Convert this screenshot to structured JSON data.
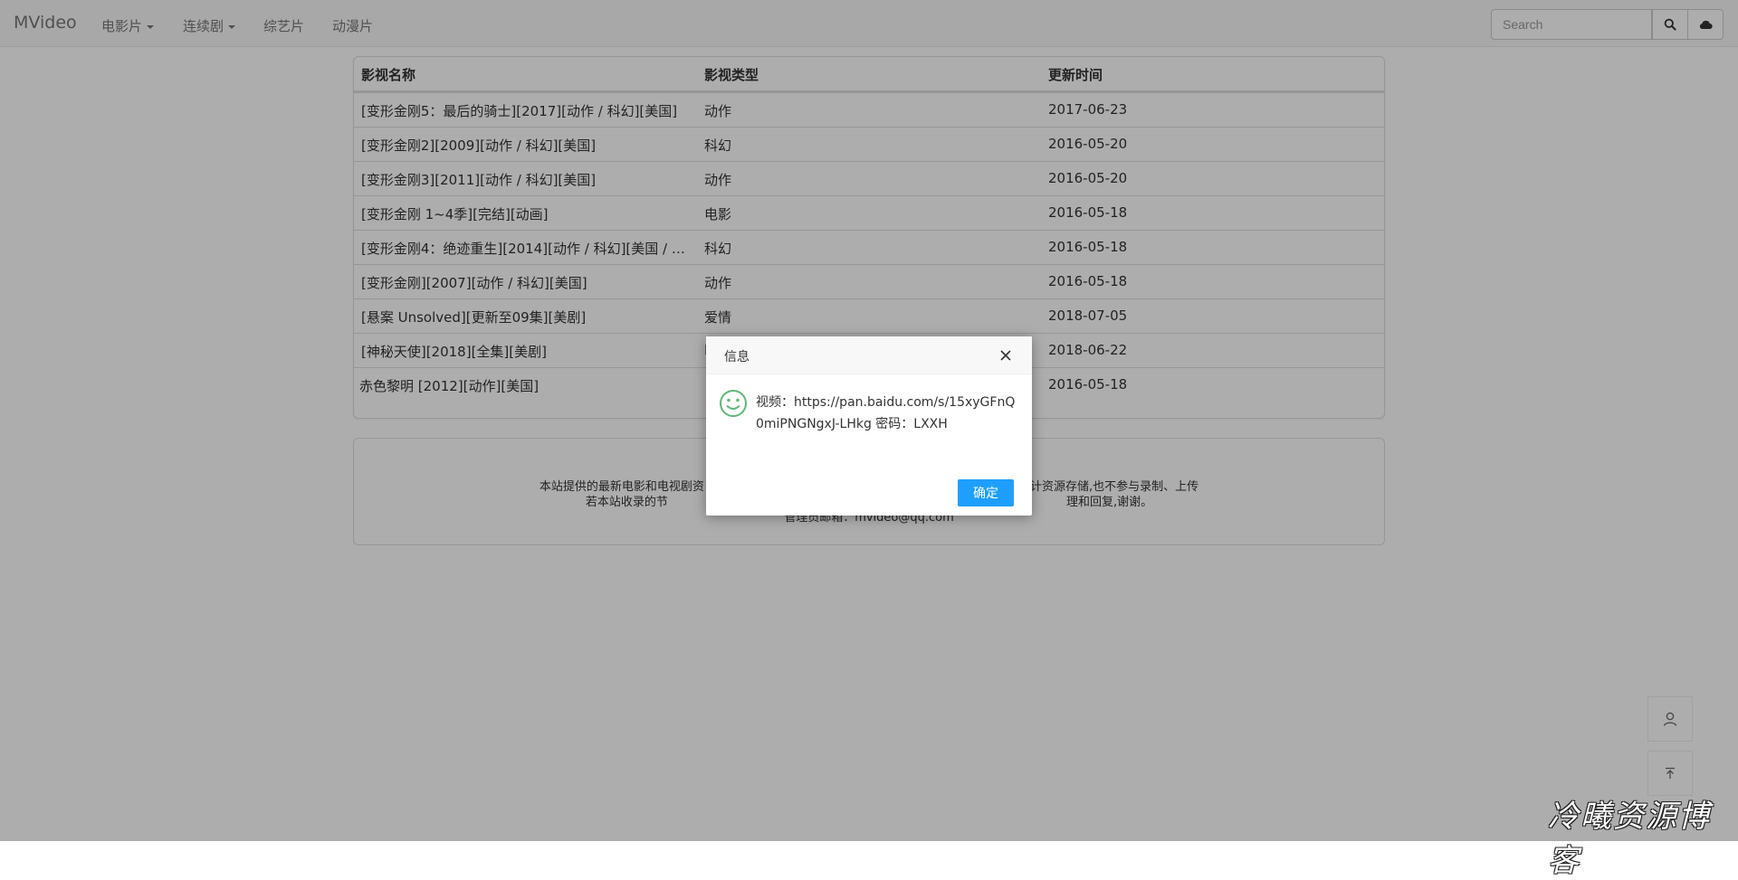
{
  "navbar": {
    "brand": "MVideo",
    "items": [
      {
        "label": "电影片",
        "dropdown": true
      },
      {
        "label": "连续剧",
        "dropdown": true
      },
      {
        "label": "综艺片",
        "dropdown": false
      },
      {
        "label": "动漫片",
        "dropdown": false
      }
    ],
    "search_placeholder": "Search",
    "search_icon": "search-icon",
    "cloud_icon": "cloud-icon"
  },
  "table": {
    "headers": [
      "影视名称",
      "影视类型",
      "更新时间"
    ],
    "rows": [
      {
        "name": "[变形金刚5：最后的骑士][2017][动作 / 科幻][美国]",
        "type": "动作",
        "date": "2017-06-23"
      },
      {
        "name": "[变形金刚2][2009][动作 / 科幻][美国]",
        "type": "科幻",
        "date": "2016-05-20"
      },
      {
        "name": "[变形金刚3][2011][动作 / 科幻][美国]",
        "type": "动作",
        "date": "2016-05-20"
      },
      {
        "name": "[变形金刚 1~4季][完结][动画]",
        "type": "电影",
        "date": "2016-05-18"
      },
      {
        "name": "[变形金刚4：绝迹重生][2014][动作 / 科幻][美国 / 中...",
        "type": "科幻",
        "date": "2016-05-18"
      },
      {
        "name": "[变形金刚][2007][动作 / 科幻][美国]",
        "type": "动作",
        "date": "2016-05-18"
      },
      {
        "name": "[悬案 Unsolved][更新至09集][美剧]",
        "type": "爱情",
        "date": "2018-07-05"
      },
      {
        "name": "[神秘天使][2018][全集][美剧]",
        "type": "I",
        "date": "2018-06-22"
      },
      {
        "name": "赤色黎明 [2012][动作][美国]",
        "type": "",
        "date": "2016-05-18"
      }
    ]
  },
  "footer": {
    "line1_left": "本站提供的最新电影和电视剧资",
    "line1_right": "计资源存储,也不参与录制、上传",
    "line2_left": "若本站收录的节",
    "line2_right": "理和回复,谢谢。",
    "line3": "管理员邮箱：mvideo@qq.com"
  },
  "side": {
    "user_icon": "user-icon",
    "top_icon": "back-to-top-icon"
  },
  "dialog": {
    "title": "信息",
    "message": "视频：https://pan.baidu.com/s/15xyGFnQ0miPNGNgxJ-LHkg   密码：LXXH",
    "ok_label": "确定",
    "icon": "smile-icon",
    "accent_color": "#1e9fff",
    "icon_color": "#5fb878"
  },
  "watermark": "冷曦资源博客"
}
